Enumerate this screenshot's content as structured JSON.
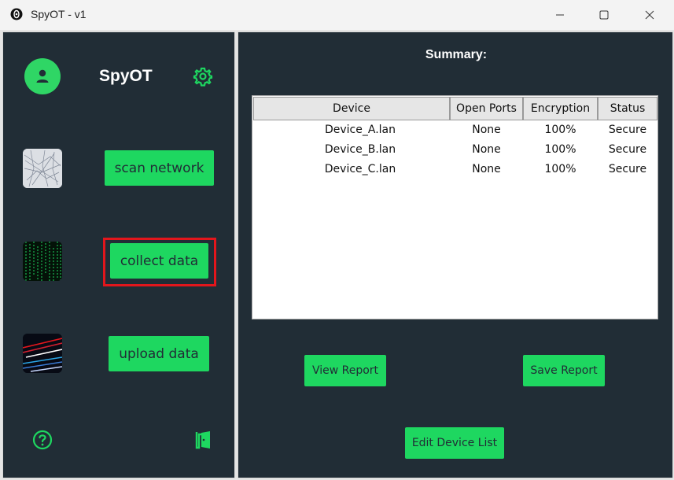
{
  "window": {
    "title": "SpyOT - v1"
  },
  "sidebar": {
    "brand": "SpyOT",
    "buttons": [
      {
        "label": "scan network",
        "thumb": "network-texture"
      },
      {
        "label": "collect data",
        "thumb": "matrix-code"
      },
      {
        "label": "upload data",
        "thumb": "light-streaks"
      }
    ]
  },
  "main": {
    "summary_title": "Summary:",
    "table": {
      "columns": [
        "Device",
        "Open Ports",
        "Encryption",
        "Status"
      ],
      "rows": [
        [
          "Device_A.lan",
          "None",
          "100%",
          "Secure"
        ],
        [
          "Device_B.lan",
          "None",
          "100%",
          "Secure"
        ],
        [
          "Device_C.lan",
          "None",
          "100%",
          "Secure"
        ]
      ]
    },
    "buttons": {
      "view_report": "View Report",
      "save_report": "Save Report",
      "edit_device_list": "Edit Device List"
    }
  },
  "colors": {
    "accent": "#1ed760",
    "panel": "#212d36",
    "highlight": "#e3161c"
  }
}
